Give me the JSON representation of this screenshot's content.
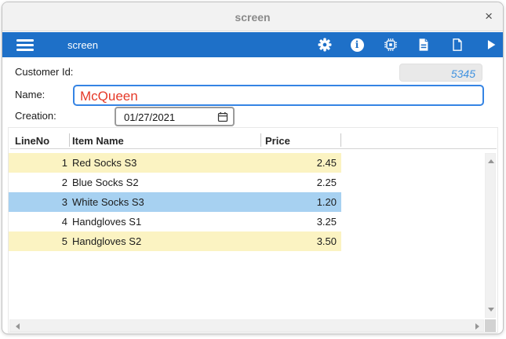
{
  "window": {
    "title": "screen",
    "close_label": "×"
  },
  "toolbar": {
    "title": "screen",
    "accent_color": "#1e70c8",
    "icons": [
      "menu-icon",
      "settings-gear-icon",
      "info-icon",
      "chip-icon",
      "document-text-icon",
      "document-blank-icon",
      "run-play-icon"
    ]
  },
  "form": {
    "customer_id": {
      "label": "Customer Id:",
      "value": "5345"
    },
    "name": {
      "label": "Name:",
      "value": "McQueen"
    },
    "creation": {
      "label": "Creation:",
      "value": "01/27/2021"
    }
  },
  "table": {
    "columns": [
      "LineNo",
      "Item Name",
      "Price"
    ],
    "rows": [
      {
        "line_no": "1",
        "item_name": "Red Socks S3",
        "price": "2.45",
        "highlight": "yellow"
      },
      {
        "line_no": "2",
        "item_name": "Blue Socks S2",
        "price": "2.25",
        "highlight": "none"
      },
      {
        "line_no": "3",
        "item_name": "White Socks S3",
        "price": "1.20",
        "highlight": "selected"
      },
      {
        "line_no": "4",
        "item_name": "Handgloves S1",
        "price": "3.25",
        "highlight": "none"
      },
      {
        "line_no": "5",
        "item_name": "Handgloves S2",
        "price": "3.50",
        "highlight": "yellow"
      }
    ],
    "row_colors": {
      "yellow": "#fbf3c2",
      "selected": "#a7d1f1"
    }
  }
}
